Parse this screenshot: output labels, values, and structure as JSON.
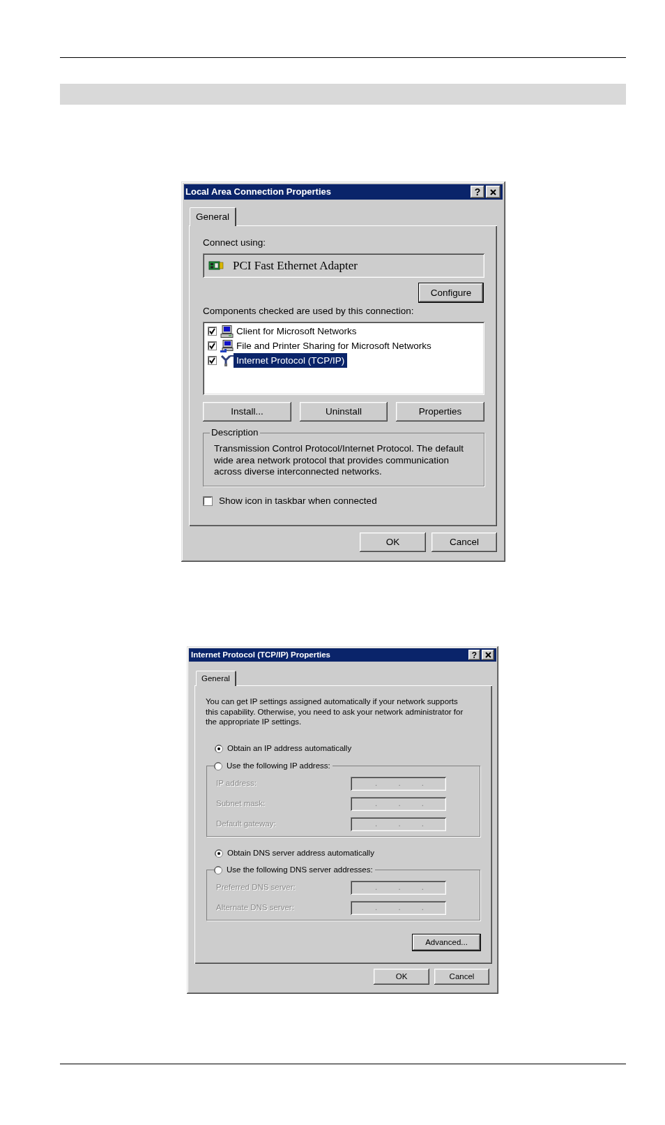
{
  "lan_dialog": {
    "title": "Local Area Connection Properties",
    "help_button": "?",
    "tabs": [
      {
        "label": "General",
        "selected": true
      }
    ],
    "connect_using_label": "Connect using:",
    "adapter": "PCI Fast Ethernet Adapter",
    "configure_button": {
      "label": "Configure",
      "default": true
    },
    "components_label": "Components checked are used by this connection:",
    "components": [
      {
        "kind": "client",
        "label": "Client for Microsoft Networks",
        "checked": true,
        "selected": false
      },
      {
        "kind": "service",
        "label": "File and Printer Sharing for Microsoft Networks",
        "checked": true,
        "selected": false
      },
      {
        "kind": "protocol",
        "label": "Internet Protocol (TCP/IP)",
        "checked": true,
        "selected": true
      }
    ],
    "component_buttons": [
      {
        "label": "Install...",
        "default": false
      },
      {
        "label": "Uninstall",
        "default": false
      },
      {
        "label": "Properties",
        "default": false
      }
    ],
    "description": {
      "legend": "Description",
      "text": "Transmission Control Protocol/Internet Protocol. The default wide area network protocol that provides communication across diverse interconnected networks."
    },
    "show_icon_checkbox": {
      "label": "Show icon in taskbar when connected",
      "checked": false
    },
    "footer_buttons": [
      {
        "label": "OK",
        "default": false
      },
      {
        "label": "Cancel",
        "default": false
      }
    ]
  },
  "tcpip_dialog": {
    "title": "Internet Protocol (TCP/IP) Properties",
    "help_button": "?",
    "tabs": [
      {
        "label": "General",
        "selected": true
      }
    ],
    "intro": "You can get IP settings assigned automatically if your network supports this capability. Otherwise, you need to ask your network administrator for the appropriate IP settings.",
    "ip_options": [
      {
        "label": "Obtain an IP address automatically",
        "selected": true
      },
      {
        "label": "Use the following IP address:",
        "selected": false
      }
    ],
    "ip_fields": [
      {
        "label": "IP address:",
        "value": ". . .",
        "disabled": true
      },
      {
        "label": "Subnet mask:",
        "value": ". . .",
        "disabled": true
      },
      {
        "label": "Default gateway:",
        "value": ". . .",
        "disabled": true
      }
    ],
    "dns_options": [
      {
        "label": "Obtain DNS server address automatically",
        "selected": true
      },
      {
        "label": "Use the following DNS server addresses:",
        "selected": false
      }
    ],
    "dns_fields": [
      {
        "label": "Preferred DNS server:",
        "value": ". . .",
        "disabled": true
      },
      {
        "label": "Alternate DNS server:",
        "value": ". . .",
        "disabled": true
      }
    ],
    "advanced_button": {
      "label": "Advanced...",
      "default": true
    },
    "footer_buttons": [
      {
        "label": "OK",
        "default": false
      },
      {
        "label": "Cancel",
        "default": false
      }
    ]
  }
}
